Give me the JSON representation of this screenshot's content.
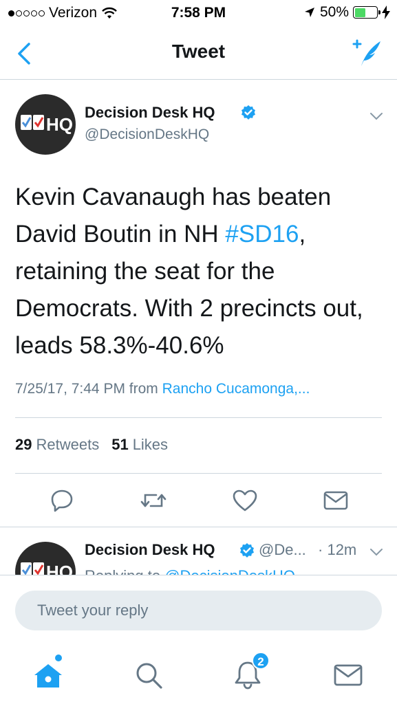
{
  "status_bar": {
    "carrier": "Verizon",
    "signal_bars_filled": 1,
    "signal_bars_total": 5,
    "time": "7:58 PM",
    "battery": "50%",
    "battery_level": 0.5,
    "battery_color": "#4cd964"
  },
  "nav": {
    "title": "Tweet",
    "back_icon": "chevron-left-icon",
    "compose_icon": "compose-tweet-icon"
  },
  "tweet": {
    "avatar_text": "HQ",
    "author_name": "Decision Desk HQ",
    "handle": "@DecisionDeskHQ",
    "text_before": "Kevin Cavanaugh has beaten David Boutin in NH ",
    "hashtag": "#SD16",
    "text_after": ", retaining the seat for the Democrats. With 2 precincts out, leads 58.3%-40.6%",
    "timestamp": "7/25/17, 7:44 PM",
    "from_label": "from",
    "source": "Rancho Cucamonga,...",
    "retweets_count": "29",
    "retweets_label": "Retweets",
    "likes_count": "51",
    "likes_label": "Likes"
  },
  "reply_preview": {
    "author_name": "Decision Desk HQ",
    "handle": "@De...",
    "separator": "·",
    "time": "12m",
    "replying_label": "Replying to",
    "replying_to": "@DecisionDeskHQ"
  },
  "composer": {
    "placeholder": "Tweet your reply"
  },
  "tab_bar": {
    "notifications_badge": "2"
  },
  "colors": {
    "accent": "#1da1f2",
    "text": "#14171a",
    "secondary": "#657786",
    "divider": "#ccd6dd",
    "avatar_bg": "#2b2b2b",
    "check_red": "#e0342f",
    "check_blue": "#4a8fd8"
  }
}
